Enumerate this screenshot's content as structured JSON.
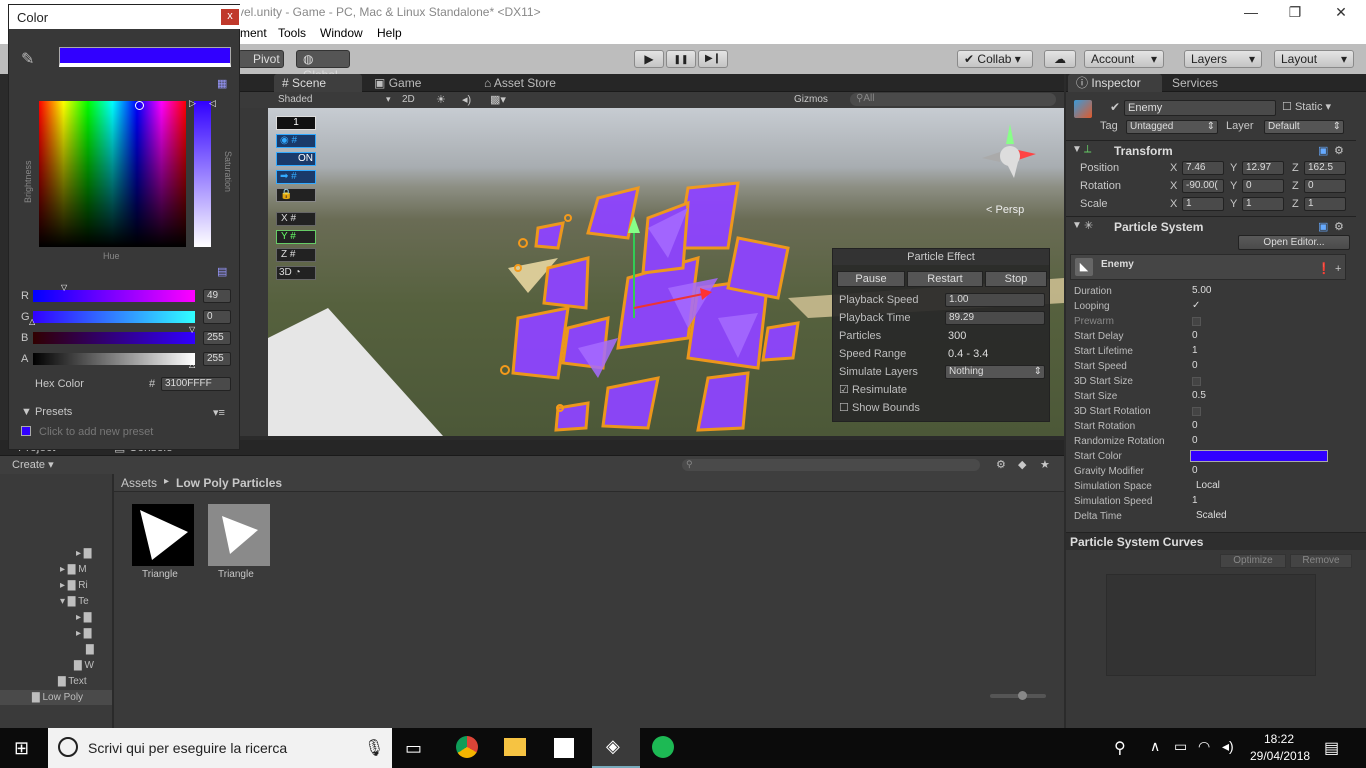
{
  "window": {
    "title": "vel.unity - Game - PC, Mac & Linux Standalone* <DX11>",
    "minimize": "—",
    "restore": "❐",
    "close": "✕"
  },
  "menu": [
    "ment",
    "Tools",
    "Window",
    "Help"
  ],
  "toolbar": {
    "pivot": "Pivot",
    "global": "Global",
    "collab": "Collab",
    "account": "Account",
    "layers": "Layers",
    "layout": "Layout",
    "play": "▶",
    "pause": "❚❚",
    "step": "▶❙"
  },
  "scene_tabs": [
    {
      "label": "Scene"
    },
    {
      "label": "Game"
    },
    {
      "label": "Asset Store"
    }
  ],
  "scene_bar": {
    "shaded": "Shaded",
    "twoD": "2D",
    "gizmos": "Gizmos",
    "search": "All",
    "persp": "< Persp"
  },
  "overlay_buttons": {
    "one": "1",
    "on": "ON",
    "x": "X",
    "y": "Y",
    "z": "Z",
    "threeD": "3D"
  },
  "particle_effect": {
    "title": "Particle Effect",
    "pause": "Pause",
    "restart": "Restart",
    "stop": "Stop",
    "rows": [
      {
        "label": "Playback Speed",
        "value": "1.00"
      },
      {
        "label": "Playback Time",
        "value": "89.29"
      },
      {
        "label": "Particles",
        "value": "300"
      },
      {
        "label": "Speed Range",
        "value": "0.4 - 3.4"
      },
      {
        "label": "Simulate Layers",
        "value": "Nothing"
      }
    ],
    "resimulate": "Resimulate",
    "show_bounds": "Show Bounds"
  },
  "color_picker": {
    "title": "Color",
    "close": "x",
    "hue_label": "Hue",
    "brightness_label": "Brightness",
    "saturation_label": "Saturation",
    "channels": [
      {
        "label": "R",
        "value": "49"
      },
      {
        "label": "G",
        "value": "0"
      },
      {
        "label": "B",
        "value": "255"
      },
      {
        "label": "A",
        "value": "255"
      }
    ],
    "hex_label": "Hex Color",
    "hex_hash": "#",
    "hex_value": "3100FFFF",
    "presets": "Presets",
    "add_preset": "Click to add new preset",
    "color": "#3100ff"
  },
  "inspector": {
    "tab": "Inspector",
    "services": "Services",
    "object_name": "Enemy",
    "static": "Static",
    "tag_label": "Tag",
    "tag_value": "Untagged",
    "layer_label": "Layer",
    "layer_value": "Default",
    "transform": {
      "title": "Transform",
      "position": {
        "label": "Position",
        "x": "7.46",
        "y": "12.97",
        "z": "162.5"
      },
      "rotation": {
        "label": "Rotation",
        "x": "-90.00(",
        "y": "0",
        "z": "0"
      },
      "scale": {
        "label": "Scale",
        "x": "1",
        "y": "1",
        "z": "1"
      }
    },
    "particle_system": {
      "title": "Particle System",
      "open_editor": "Open Editor...",
      "module": "Enemy",
      "props": [
        {
          "label": "Duration",
          "value": "5.00"
        },
        {
          "label": "Looping",
          "value": "✓"
        },
        {
          "label": "Prewarm",
          "value": ""
        },
        {
          "label": "Start Delay",
          "value": "0"
        },
        {
          "label": "Start Lifetime",
          "value": "1"
        },
        {
          "label": "Start Speed",
          "value": "0"
        },
        {
          "label": "3D Start Size",
          "value": ""
        },
        {
          "label": "Start Size",
          "value": "0.5"
        },
        {
          "label": "3D Start Rotation",
          "value": ""
        },
        {
          "label": "Start Rotation",
          "value": "0"
        },
        {
          "label": "Randomize Rotation",
          "value": "0"
        },
        {
          "label": "Start Color",
          "value": ""
        },
        {
          "label": "Gravity Modifier",
          "value": "0"
        },
        {
          "label": "Simulation Space",
          "value": "Local"
        },
        {
          "label": "Simulation Speed",
          "value": "1"
        },
        {
          "label": "Delta Time",
          "value": "Scaled"
        }
      ]
    },
    "curves": {
      "title": "Particle System Curves",
      "optimize": "Optimize",
      "remove": "Remove"
    }
  },
  "project": {
    "tab_project": "Project",
    "tab_console": "Console",
    "create": "Create",
    "breadcrumb_root": "Assets",
    "breadcrumb_sep": "▸",
    "breadcrumb_current": "Low Poly Particles",
    "assets": [
      {
        "name": "Triangle"
      },
      {
        "name": "Triangle"
      }
    ],
    "tree": [
      "M",
      "Ri",
      "Te",
      "W",
      "Text",
      "Low Poly"
    ]
  },
  "taskbar": {
    "search": "Scrivi qui per eseguire la ricerca",
    "time": "18:22",
    "date": "29/04/2018"
  }
}
